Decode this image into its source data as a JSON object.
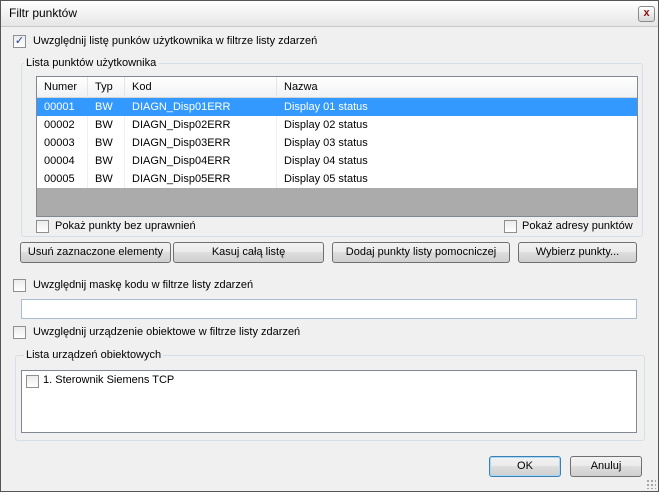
{
  "window": {
    "title": "Filtr punktów",
    "close_glyph": "x"
  },
  "user_points": {
    "include_label": "Uwzględnij listę punków użytkownika w filtrze listy zdarzeń",
    "include_checked": true,
    "group_label": "Lista punktów użytkownika",
    "columns": {
      "numer": "Numer",
      "typ": "Typ",
      "kod": "Kod",
      "nazwa": "Nazwa"
    },
    "rows": [
      {
        "numer": "00001",
        "typ": "BW",
        "kod": "DIAGN_Disp01ERR",
        "nazwa": "Display 01 status",
        "selected": true
      },
      {
        "numer": "00002",
        "typ": "BW",
        "kod": "DIAGN_Disp02ERR",
        "nazwa": "Display 02 status",
        "selected": false
      },
      {
        "numer": "00003",
        "typ": "BW",
        "kod": "DIAGN_Disp03ERR",
        "nazwa": "Display 03 status",
        "selected": false
      },
      {
        "numer": "00004",
        "typ": "BW",
        "kod": "DIAGN_Disp04ERR",
        "nazwa": "Display 04 status",
        "selected": false
      },
      {
        "numer": "00005",
        "typ": "BW",
        "kod": "DIAGN_Disp05ERR",
        "nazwa": "Display 05 status",
        "selected": false
      }
    ],
    "show_no_permission_label": "Pokaż punkty bez uprawnień",
    "show_addresses_label": "Pokaż adresy punktów",
    "buttons": {
      "remove_selected": "Usuń zaznaczone elementy",
      "clear_list": "Kasuj całą listę",
      "add_aux": "Dodaj punkty listy pomocniczej",
      "select_points": "Wybierz punkty..."
    }
  },
  "code_mask": {
    "include_label": "Uwzględnij maskę kodu w filtrze listy zdarzeń",
    "include_checked": false,
    "value": ""
  },
  "devices": {
    "include_label": "Uwzględnij urządzenie obiektowe w filtrze listy zdarzeń",
    "include_checked": false,
    "group_label": "Lista urządzeń obiektowych",
    "items": [
      {
        "label": "1. Sterownik Siemens TCP",
        "checked": false
      }
    ]
  },
  "footer": {
    "ok": "OK",
    "cancel": "Anuluj"
  },
  "colors": {
    "selection": "#3399ff",
    "dialog_bg": "#f0f0f0",
    "list_empty_bg": "#ababab"
  },
  "icons": {
    "check": "checkmark-icon",
    "close": "close-icon"
  }
}
